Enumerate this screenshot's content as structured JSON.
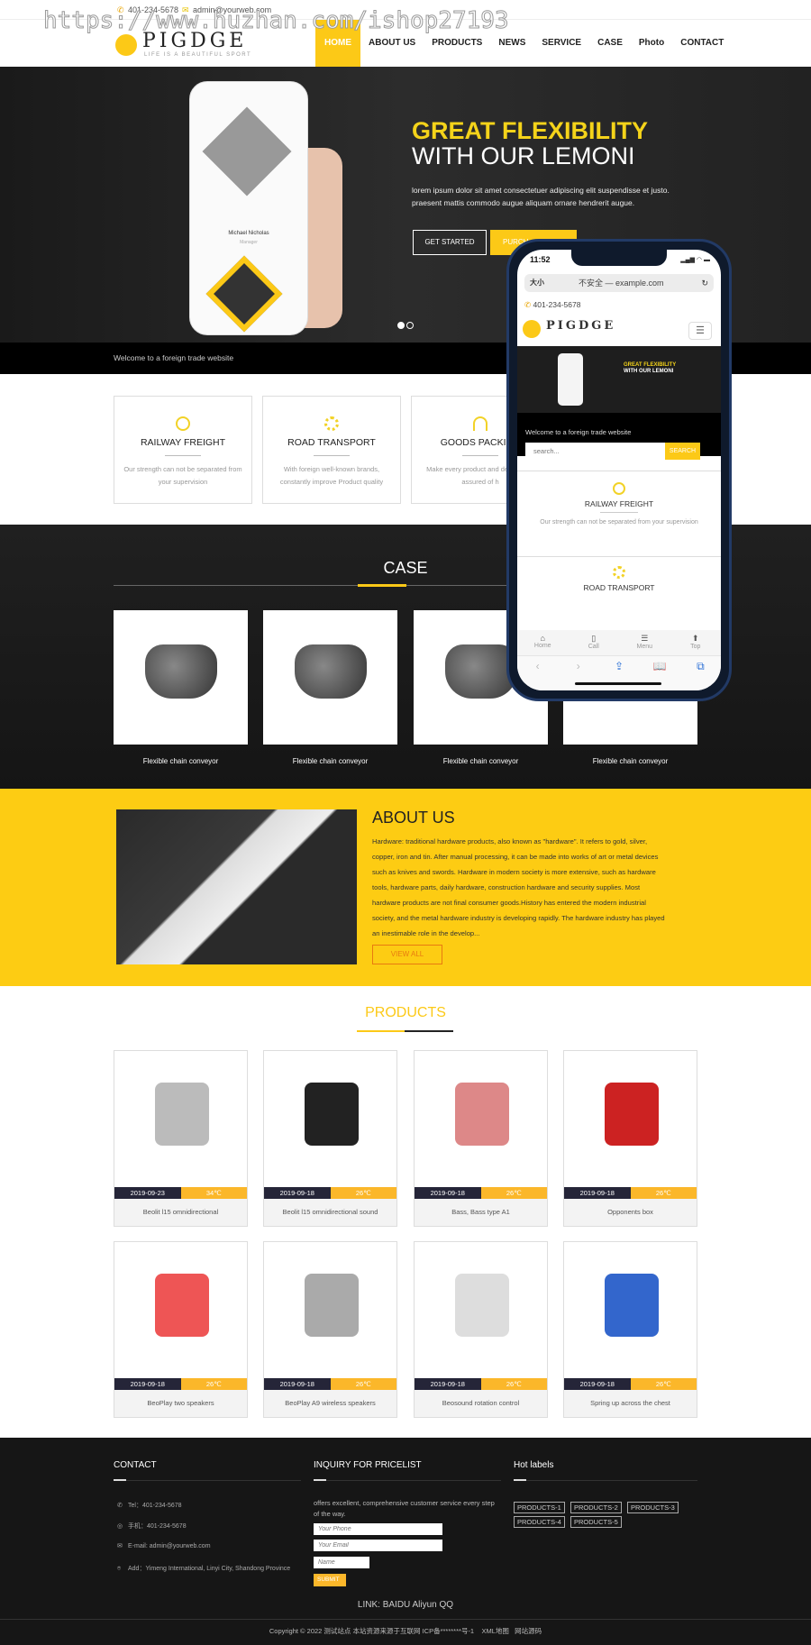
{
  "watermark": "https://www.huzhan.com/ishop27193",
  "topbar": {
    "phone": "401-234-5678",
    "email": "admin@yourweb.com"
  },
  "brand": {
    "name": "PIGDGE",
    "tagline": "LIFE IS A BEAUTIFUL SPORT",
    "accent": "#fcc917"
  },
  "nav": [
    "HOME",
    "ABOUT US",
    "PRODUCTS",
    "NEWS",
    "SERVICE",
    "CASE",
    "Photo",
    "CONTACT"
  ],
  "hero": {
    "title_yellow": "GREAT FLEXIBILITY",
    "title_white": "WITH OUR LEMONI",
    "text": "lorem ipsum dolor sit amet consectetuer adipiscing elit suspendisse et justo. praesent mattis commodo augue aliquam ornare hendrerit augue.",
    "btn_start": "GET STARTED",
    "btn_purchase": "PURCH",
    "phone_name": "Michael Nicholas",
    "phone_role": "Manager",
    "slide_index": 1,
    "slide_count": 2
  },
  "welcome": "Welcome to a foreign trade website",
  "features": [
    {
      "title": "RAILWAY FREIGHT",
      "text": "Our strength can not be separated from your supervision"
    },
    {
      "title": "ROAD TRANSPORT",
      "text": "With foreign well-known brands, constantly improve Product quality"
    },
    {
      "title": "GOODS PACKING",
      "text": "Make every product and de use rest assured of h"
    }
  ],
  "case": {
    "title": "CASE",
    "items": [
      "Flexible chain conveyor",
      "Flexible chain conveyor",
      "Flexible chain conveyor",
      "Flexible chain conveyor"
    ]
  },
  "about": {
    "title": "ABOUT US",
    "text": "Hardware: traditional hardware products, also known as \"hardware\". It refers to gold, silver, copper, iron and tin. After manual processing, it can be made into works of art or metal devices such as knives and swords. Hardware in modern society is more extensive, such as hardware tools, hardware parts, daily hardware, construction hardware and security supplies. Most hardware products are not final consumer goods.History has entered the modern industrial society, and the metal hardware industry is developing rapidly. The hardware industry has played an inestimable role in the develop...",
    "button": "VIEW ALL"
  },
  "products": {
    "title": "PRODUCTS",
    "items": [
      {
        "date": "2019-09-23",
        "temp": "34℃",
        "name": "Beolit l15 omnidirectional"
      },
      {
        "date": "2019-09-18",
        "temp": "26℃",
        "name": "Beolit l15 omnidirectional sound"
      },
      {
        "date": "2019-09-18",
        "temp": "26℃",
        "name": "Bass, Bass type A1"
      },
      {
        "date": "2019-09-18",
        "temp": "26℃",
        "name": "Opponents box"
      },
      {
        "date": "2019-09-18",
        "temp": "26℃",
        "name": "BeoPlay two speakers"
      },
      {
        "date": "2019-09-18",
        "temp": "26℃",
        "name": "BeoPlay A9 wireless speakers"
      },
      {
        "date": "2019-09-18",
        "temp": "26℃",
        "name": "Beosound rotation control"
      },
      {
        "date": "2019-09-18",
        "temp": "26℃",
        "name": "Spring up across the chest"
      }
    ]
  },
  "footer": {
    "contact_title": "CONTACT",
    "tel": "Tel：401-234-5678",
    "mobile": "手机：401-234-5678",
    "email": "E-mail: admin@yourweb.com",
    "address": "Add：Yimeng International, Linyi City, Shandong Province",
    "inquiry_title": "INQUIRY FOR PRICELIST",
    "inquiry_text": "offers excellent, comprehensive customer service every step of the way.",
    "phone_placeholder": "Your Phone",
    "email_placeholder": "Your Email",
    "name_placeholder": "Name",
    "submit": "SUBMIT",
    "labels_title": "Hot labels",
    "labels": [
      "PRODUCTS-1",
      "PRODUCTS-2",
      "PRODUCTS-3",
      "PRODUCTS-4",
      "PRODUCTS-5"
    ],
    "links": "LINK: BAIDU Aliyun QQ",
    "copyright": "Copyright © 2022 测试站点 本站资源来源于互联网 ICP备********号-1",
    "xml": "XML地图",
    "source": "网站源码"
  },
  "mobile": {
    "time": "11:52",
    "size": "大小",
    "address": "不安全 — example.com",
    "phone": "401-234-5678",
    "search_placeholder": "search...",
    "search_btn": "SEARCH",
    "feature1_text": "Our strength can not be separated from your supervision",
    "tabs": [
      "Home",
      "Call",
      "Menu",
      "Top"
    ]
  }
}
